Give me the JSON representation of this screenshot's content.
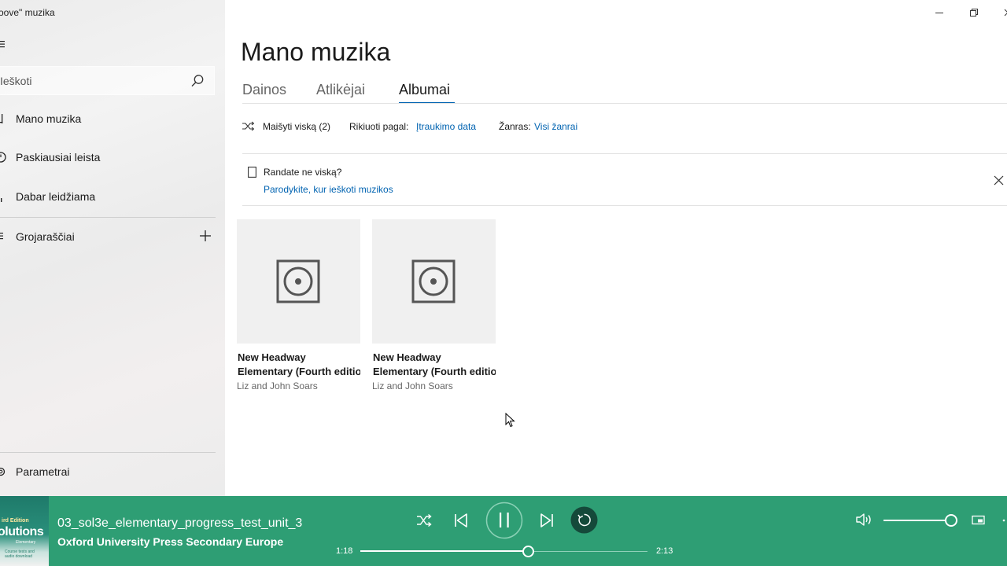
{
  "app": {
    "title": "oove\" muzika"
  },
  "sidebar": {
    "search_placeholder": "Ieškoti",
    "items": [
      {
        "label": "Mano muzika"
      },
      {
        "label": "Paskiausiai leista"
      },
      {
        "label": "Dabar leidžiama"
      },
      {
        "label": "Grojaraščiai"
      }
    ],
    "settings_label": "Parametrai"
  },
  "main": {
    "title": "Mano muzika",
    "tabs": [
      {
        "label": "Dainos"
      },
      {
        "label": "Atlikėjai"
      },
      {
        "label": "Albumai",
        "active": true
      }
    ],
    "toolbar": {
      "shuffle_label": "Maišyti viską (2)",
      "sort_label": "Rikiuoti pagal:",
      "sort_value": "Įtraukimo data",
      "genre_label": "Žanras:",
      "genre_value": "Visi žanrai"
    },
    "notice": {
      "title": "Randate ne viską?",
      "link": "Parodykite, kur ieškoti muzikos"
    },
    "albums": [
      {
        "title_line1": "New Headway",
        "title_line2": "Elementary (Fourth edition)",
        "artist": "Liz and John Soars"
      },
      {
        "title_line1": "New Headway",
        "title_line2": "Elementary (Fourth edition)",
        "artist": "Liz and John Soars"
      }
    ]
  },
  "player": {
    "cover": {
      "line1": "ird Edition",
      "line2": "olutions",
      "line3": "Elementary",
      "line4": "Course tests and",
      "line5": "audio download"
    },
    "track_title": "03_sol3e_elementary_progress_test_unit_3",
    "track_artist": "Oxford University Press Secondary Europe",
    "time_elapsed": "1:18",
    "time_total": "2:13",
    "progress_fraction": 0.584,
    "volume_fraction": 1.0,
    "accent": "#2e9e74"
  },
  "colors": {
    "link": "#0063b1",
    "sidebar_bg": "#ececec",
    "player_bg": "#2e9e74"
  }
}
